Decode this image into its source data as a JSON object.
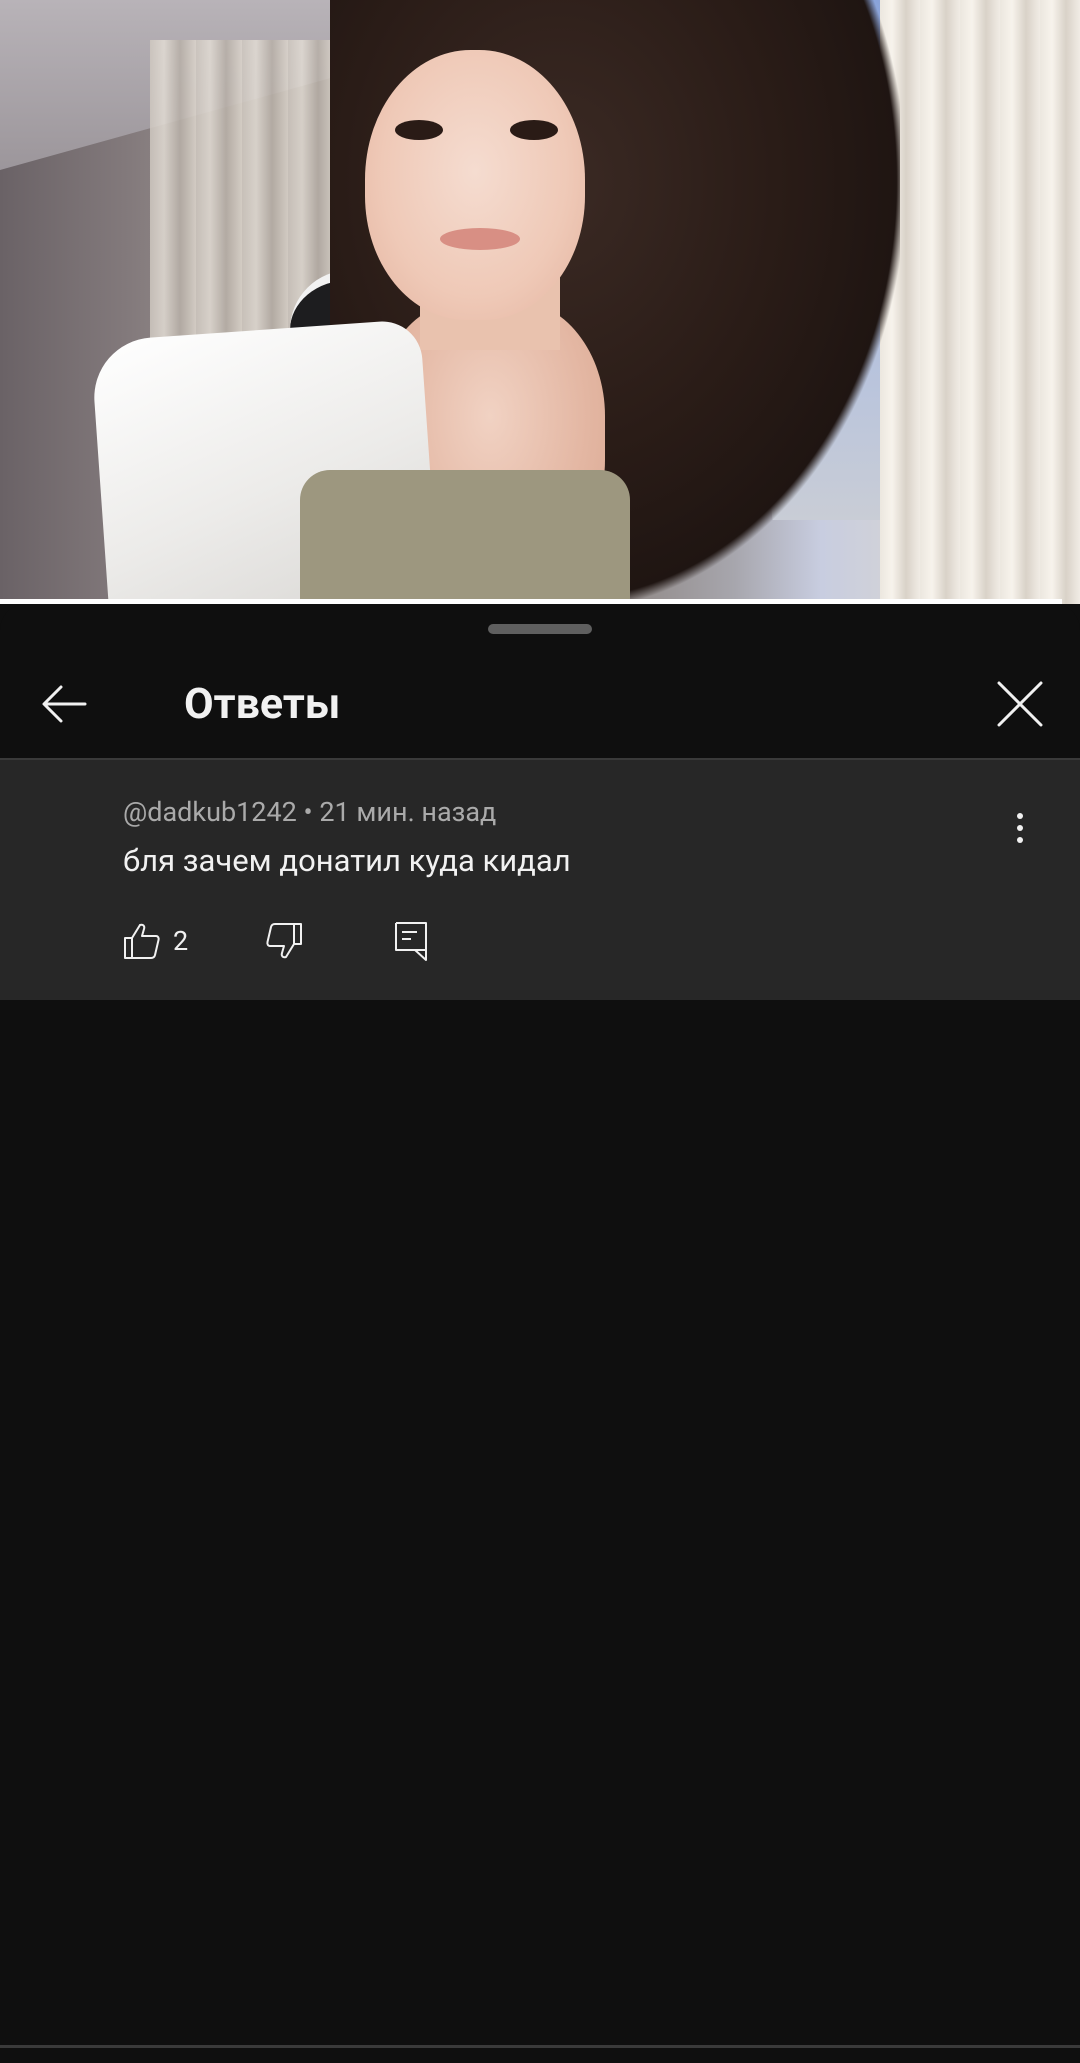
{
  "video": {
    "progress_fraction": 0.983
  },
  "sheet": {
    "title": "Ответы",
    "back_icon": "arrow-left-icon",
    "close_icon": "close-icon"
  },
  "comment": {
    "author": "@dadkub1242",
    "separator": "•",
    "time": "21 мин. назад",
    "text": "бля зачем донатил куда кидал",
    "likes": "2",
    "icons": [
      "thumbs-up-icon",
      "thumbs-down-icon",
      "reply-icon",
      "more-vert-icon"
    ]
  },
  "colors": {
    "background": "#0f0f0f",
    "comment_bg": "#272727",
    "text_primary": "#f1f1f1",
    "text_secondary": "#aaaaaa"
  }
}
